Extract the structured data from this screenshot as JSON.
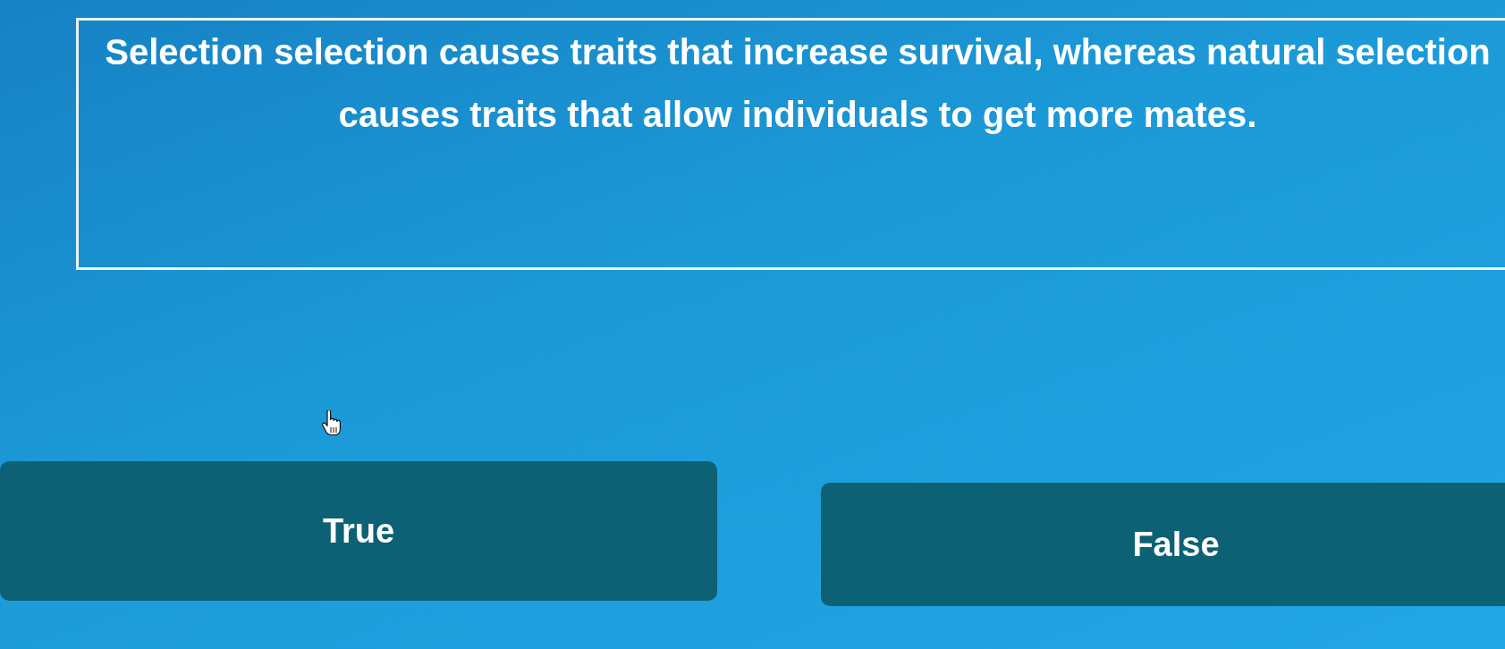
{
  "question": {
    "text": "Selection selection causes traits that increase survival, whereas natural selection causes traits that allow individuals to get more mates."
  },
  "options": [
    {
      "label": "True"
    },
    {
      "label": "False"
    }
  ]
}
